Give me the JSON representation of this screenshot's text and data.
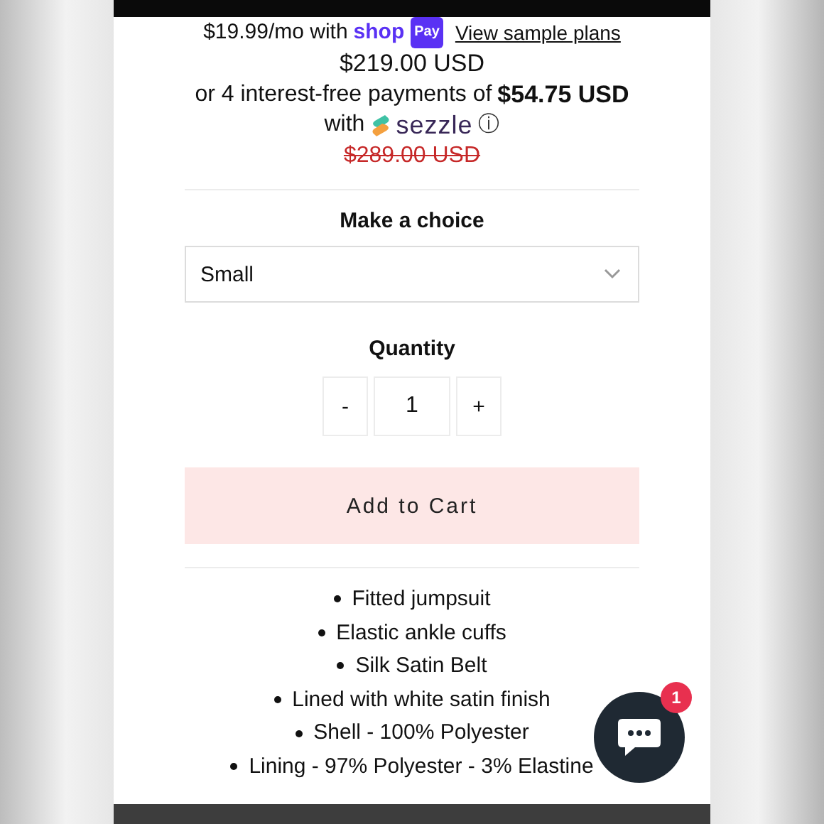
{
  "installments": {
    "amount": "$19.99/mo with",
    "provider": "shop",
    "provider_badge": "Pay",
    "link": "View sample plans"
  },
  "price": "$219.00 USD",
  "sezzle": {
    "text": "or 4 interest-free payments of",
    "amount": "$54.75 USD",
    "with": "with",
    "logo": "sezzle",
    "info": "ⓘ"
  },
  "compare_price": "$289.00 USD",
  "variant": {
    "label": "Make a choice",
    "value": "Small"
  },
  "quantity": {
    "label": "Quantity",
    "decrement": "-",
    "value": "1",
    "increment": "+"
  },
  "add_to_cart": "Add to Cart",
  "features": [
    "Fitted jumpsuit",
    "Elastic ankle cuffs",
    "Silk Satin Belt",
    "Lined with white satin finish",
    "Shell - 100% Polyester",
    "Lining - 97% Polyester - 3% Elastine"
  ],
  "chat": {
    "badge": "1"
  }
}
